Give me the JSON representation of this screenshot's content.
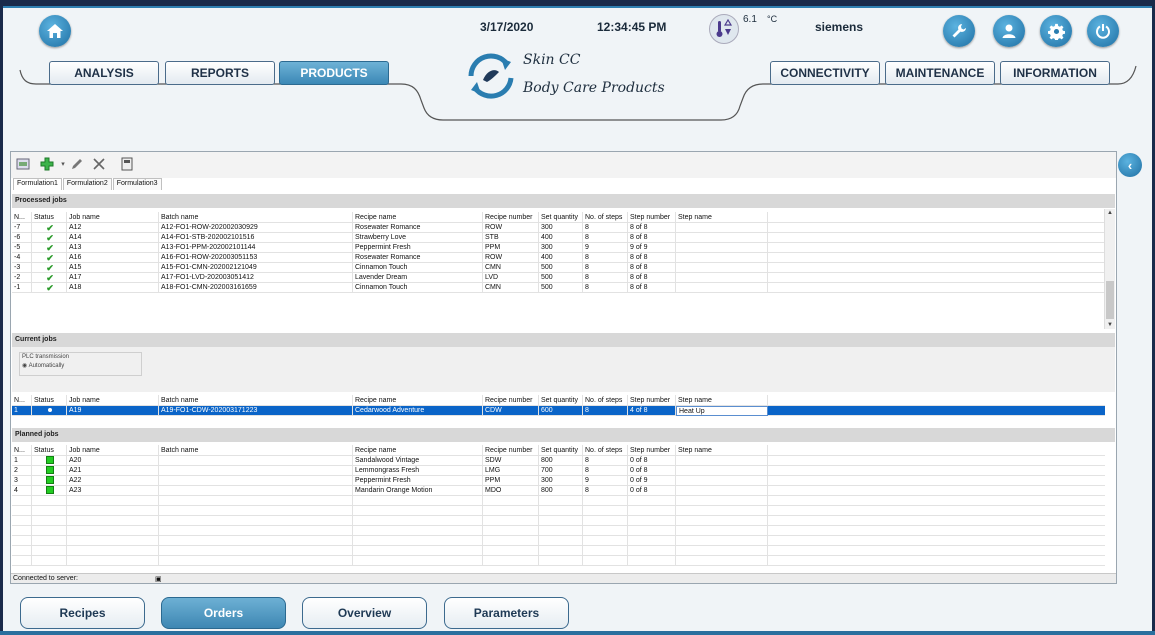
{
  "header": {
    "date": "3/17/2020",
    "time": "12:34:45 PM",
    "temperature": "6.1",
    "temp_unit": "°C",
    "user": "siemens"
  },
  "logo": {
    "line1": "Skin CC",
    "line2": "Body Care Products"
  },
  "nav_left": [
    "ANALYSIS",
    "REPORTS",
    "PRODUCTS"
  ],
  "nav_right": [
    "CONNECTIVITY",
    "MAINTENANCE",
    "INFORMATION"
  ],
  "subtabs": [
    "Formulation1",
    "Formulation2",
    "Formulation3"
  ],
  "sections": {
    "processed": "Processed jobs",
    "current": "Current jobs",
    "planned": "Planned jobs"
  },
  "plc": {
    "title": "PLC transmission",
    "option": "Automatically"
  },
  "columns": [
    "N...",
    "Status",
    "Job name",
    "Batch name",
    "Recipe name",
    "Recipe number",
    "Set quantity",
    "No. of steps",
    "Step number",
    "Step name"
  ],
  "processed_jobs": [
    {
      "n": "-7",
      "job": "A12",
      "batch": "A12-FO1-ROW-202002030929",
      "recipe": "Rosewater Romance",
      "num": "ROW",
      "qty": "300",
      "steps": "8",
      "stepnum": "8 of 8",
      "stepname": ""
    },
    {
      "n": "-6",
      "job": "A14",
      "batch": "A14-FO1-STB-202002101516",
      "recipe": "Strawberry Love",
      "num": "STB",
      "qty": "400",
      "steps": "8",
      "stepnum": "8 of 8",
      "stepname": ""
    },
    {
      "n": "-5",
      "job": "A13",
      "batch": "A13-FO1-PPM-202002101144",
      "recipe": "Peppermint Fresh",
      "num": "PPM",
      "qty": "300",
      "steps": "9",
      "stepnum": "9 of 9",
      "stepname": ""
    },
    {
      "n": "-4",
      "job": "A16",
      "batch": "A16-FO1-ROW-202003051153",
      "recipe": "Rosewater Romance",
      "num": "ROW",
      "qty": "400",
      "steps": "8",
      "stepnum": "8 of 8",
      "stepname": ""
    },
    {
      "n": "-3",
      "job": "A15",
      "batch": "A15-FO1-CMN-202002121049",
      "recipe": "Cinnamon Touch",
      "num": "CMN",
      "qty": "500",
      "steps": "8",
      "stepnum": "8 of 8",
      "stepname": ""
    },
    {
      "n": "-2",
      "job": "A17",
      "batch": "A17-FO1-LVD-202003051412",
      "recipe": "Lavender Dream",
      "num": "LVD",
      "qty": "500",
      "steps": "8",
      "stepnum": "8 of 8",
      "stepname": ""
    },
    {
      "n": "-1",
      "job": "A18",
      "batch": "A18-FO1-CMN-202003161659",
      "recipe": "Cinnamon Touch",
      "num": "CMN",
      "qty": "500",
      "steps": "8",
      "stepnum": "8 of 8",
      "stepname": ""
    }
  ],
  "current_jobs": [
    {
      "n": "1",
      "job": "A19",
      "batch": "A19-FO1-CDW-202003171223",
      "recipe": "Cedarwood Adventure",
      "num": "CDW",
      "qty": "600",
      "steps": "8",
      "stepnum": "4 of 8",
      "stepname": "Heat Up"
    }
  ],
  "planned_jobs": [
    {
      "n": "1",
      "job": "A20",
      "batch": "",
      "recipe": "Sandalwood Vintage",
      "num": "SDW",
      "qty": "800",
      "steps": "8",
      "stepnum": "0 of 8",
      "stepname": ""
    },
    {
      "n": "2",
      "job": "A21",
      "batch": "",
      "recipe": "Lemmongrass Fresh",
      "num": "LMG",
      "qty": "700",
      "steps": "8",
      "stepnum": "0 of 8",
      "stepname": ""
    },
    {
      "n": "3",
      "job": "A22",
      "batch": "",
      "recipe": "Peppermint Fresh",
      "num": "PPM",
      "qty": "300",
      "steps": "9",
      "stepnum": "0 of 9",
      "stepname": ""
    },
    {
      "n": "4",
      "job": "A23",
      "batch": "",
      "recipe": "Mandarin Orange Motion",
      "num": "MDO",
      "qty": "800",
      "steps": "8",
      "stepnum": "0 of 8",
      "stepname": ""
    }
  ],
  "statusbar": "Connected to server:",
  "bottom_buttons": [
    "Recipes",
    "Orders",
    "Overview",
    "Parameters"
  ],
  "colors": {
    "accent": "#3b88b6",
    "selection": "#0a64c8",
    "status_ok": "#2a9a2a",
    "status_planned": "#22cc22"
  },
  "icons": [
    "home-icon",
    "thermometer-icon",
    "wrench-icon",
    "user-icon",
    "gear-icon",
    "power-icon",
    "back-arrow-icon"
  ]
}
